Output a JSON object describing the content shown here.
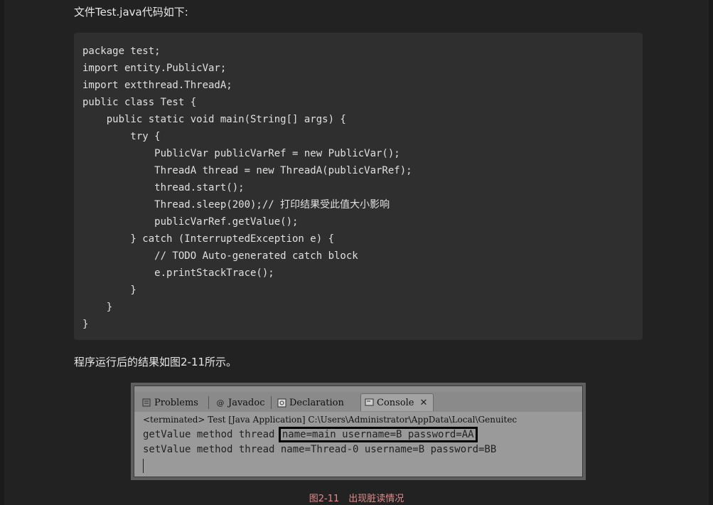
{
  "intro_text": "文件Test.java代码如下:",
  "code_lines": [
    "package test;",
    "import entity.PublicVar;",
    "import extthread.ThreadA;",
    "public class Test {",
    "    public static void main(String[] args) {",
    "        try {",
    "            PublicVar publicVarRef = new PublicVar();",
    "            ThreadA thread = new ThreadA(publicVarRef);",
    "            thread.start();",
    "            Thread.sleep(200);// 打印结果受此值大小影响",
    "            publicVarRef.getValue();",
    "        } catch (InterruptedException e) {",
    "            // TODO Auto-generated catch block",
    "            e.printStackTrace();",
    "        }",
    "    }",
    "}"
  ],
  "result_text": "程序运行后的结果如图2-11所示。",
  "console_screenshot": {
    "tabs": {
      "problems": "Problems",
      "javadoc": "Javadoc",
      "declaration": "Declaration",
      "console": "Console"
    },
    "terminated_line": "<terminated> Test [Java Application] C:\\Users\\Administrator\\AppData\\Local\\Genuitec",
    "line1_prefix": "getValue method thread ",
    "line1_highlight": "name=main username=B password=AA",
    "line2": "setValue method thread name=Thread-0 username=B password=BB"
  },
  "caption": "图2-11　出现脏读情况"
}
